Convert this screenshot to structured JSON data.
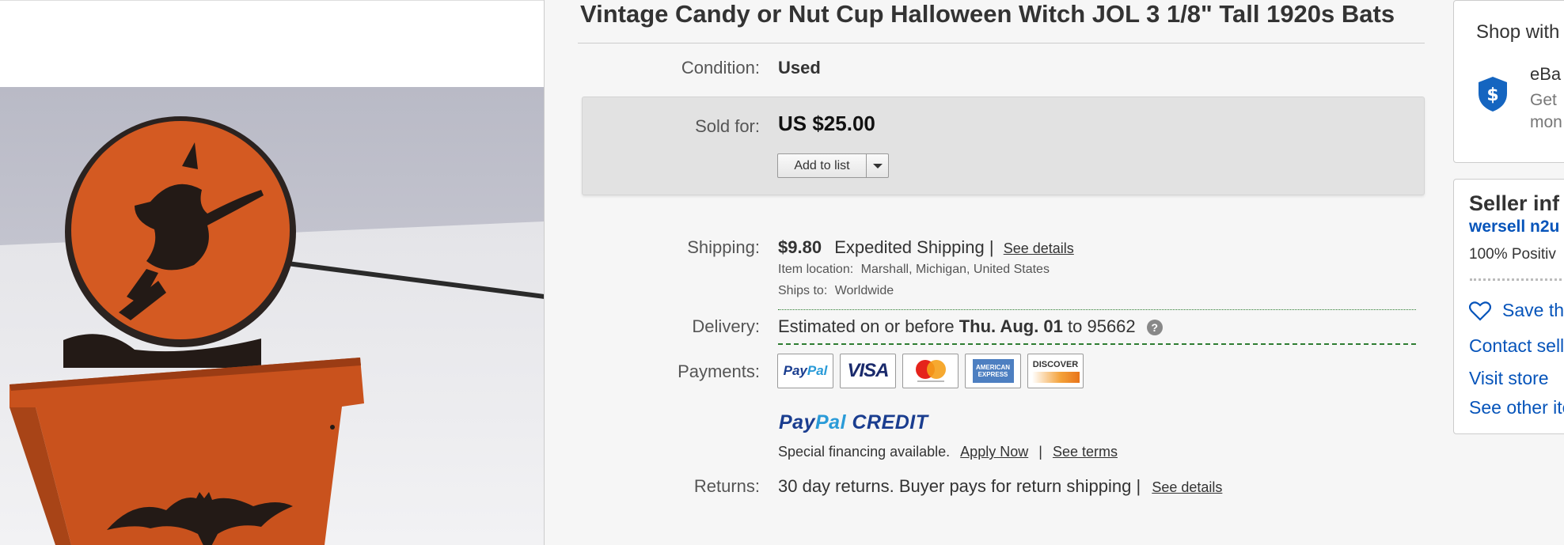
{
  "item": {
    "title": "Vintage Candy or Nut Cup Halloween Witch JOL 3 1/8\" Tall 1920s Bats"
  },
  "condition": {
    "label": "Condition:",
    "value": "Used"
  },
  "sold": {
    "label": "Sold for:",
    "price": "US $25.00",
    "add_to_list": "Add to list"
  },
  "shipping": {
    "label": "Shipping:",
    "cost": "$9.80",
    "method": "Expedited Shipping |",
    "details_link": "See details",
    "location_label": "Item location:",
    "location": "Marshall, Michigan, United States",
    "ships_to_label": "Ships to:",
    "ships_to": "Worldwide"
  },
  "delivery": {
    "label": "Delivery:",
    "prefix": "Estimated on or before",
    "date": "Thu. Aug. 01",
    "to_text": "to 95662",
    "help": "?"
  },
  "payments": {
    "label": "Payments:",
    "cards": [
      "PayPal",
      "VISA",
      "mastercard",
      "AMERICAN EXPRESS",
      "DISCOVER"
    ],
    "paypal_credit": {
      "part1": "PayPal",
      "part2": "CREDIT"
    },
    "financing_text": "Special financing available.",
    "apply_link": "Apply Now",
    "separator": "|",
    "terms_link": "See terms"
  },
  "returns": {
    "label": "Returns:",
    "text": "30 day returns. Buyer pays for return shipping |",
    "details_link": "See details"
  },
  "shop_box": {
    "title": "Shop with",
    "line1": "eBa",
    "line2": "Get",
    "line3": "mon"
  },
  "seller": {
    "title": "Seller inf",
    "name": "wersell n2u",
    "feedback": "100% Positiv",
    "save": "Save th",
    "contact": "Contact sell",
    "visit": "Visit store",
    "other": "See other ite"
  },
  "colors": {
    "link_blue": "#0654ba",
    "guarantee_blue": "#1565c0",
    "pumpkin": "#d2571f",
    "delivery_green": "#2e7d32"
  }
}
